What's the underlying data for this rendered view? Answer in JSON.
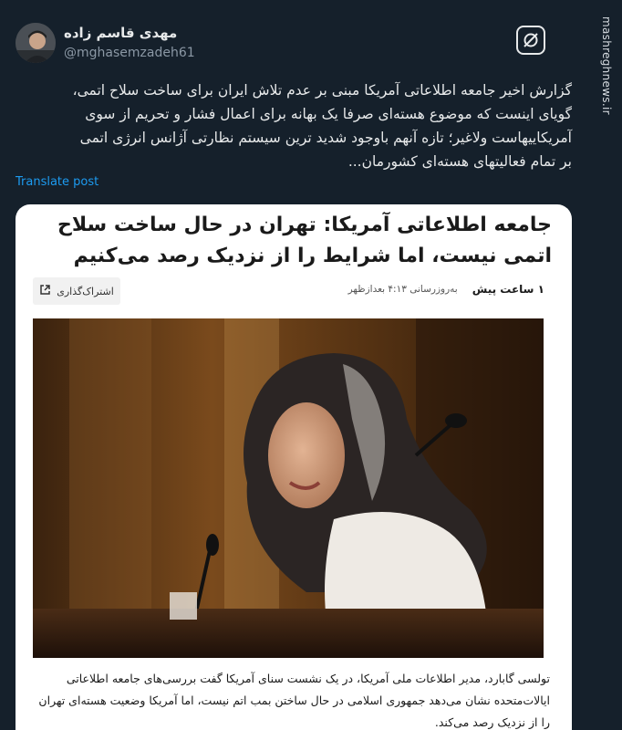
{
  "author": {
    "name": "مهدی قاسم زاده",
    "handle": "@mghasemzadeh61"
  },
  "tweet": {
    "lines": [
      "گزارش اخیر جامعه اطلاعاتی آمریکا مبنی بر عدم تلاش ایران برای ساخت سلاح اتمی،",
      "گویای اینست که موضوع هسته‌ای صرفا یک بهانه برای اعمال فشار و تحریم از سوی",
      "آمریکاییهاست ولاغیر؛ تازه آنهم باوجود شدید ترین سیستم نظارتی آژانس انرژی اتمی",
      "بر تمام فعالیتهای هسته‌ای کشورمان..."
    ],
    "translate_label": "Translate post"
  },
  "card": {
    "title": "جامعه اطلاعاتی آمریکا: تهران در حال ساخت سلاح اتمی نیست، اما شرایط را از نزدیک رصد می‌کنیم",
    "time_ago": "۱ ساعت پیش",
    "updated": "به‌روزرسانی ۴:۱۳ بعدازظهر",
    "share_label": "اشتراک‌گذاری",
    "caption": "تولسی گابارد، مدیر اطلاعات ملی آمریکا، در یک نشست سنای آمریکا گفت بررسی‌های جامعه اطلاعاتی ایالات‌متحده نشان می‌دهد جمهوری اسلامی در حال ساختن بمب اتم نیست، اما آمریکا وضعیت هسته‌ای تهران را از نزدیک رصد می‌کند."
  },
  "watermark": {
    "text": "mashreghnews.ir"
  }
}
